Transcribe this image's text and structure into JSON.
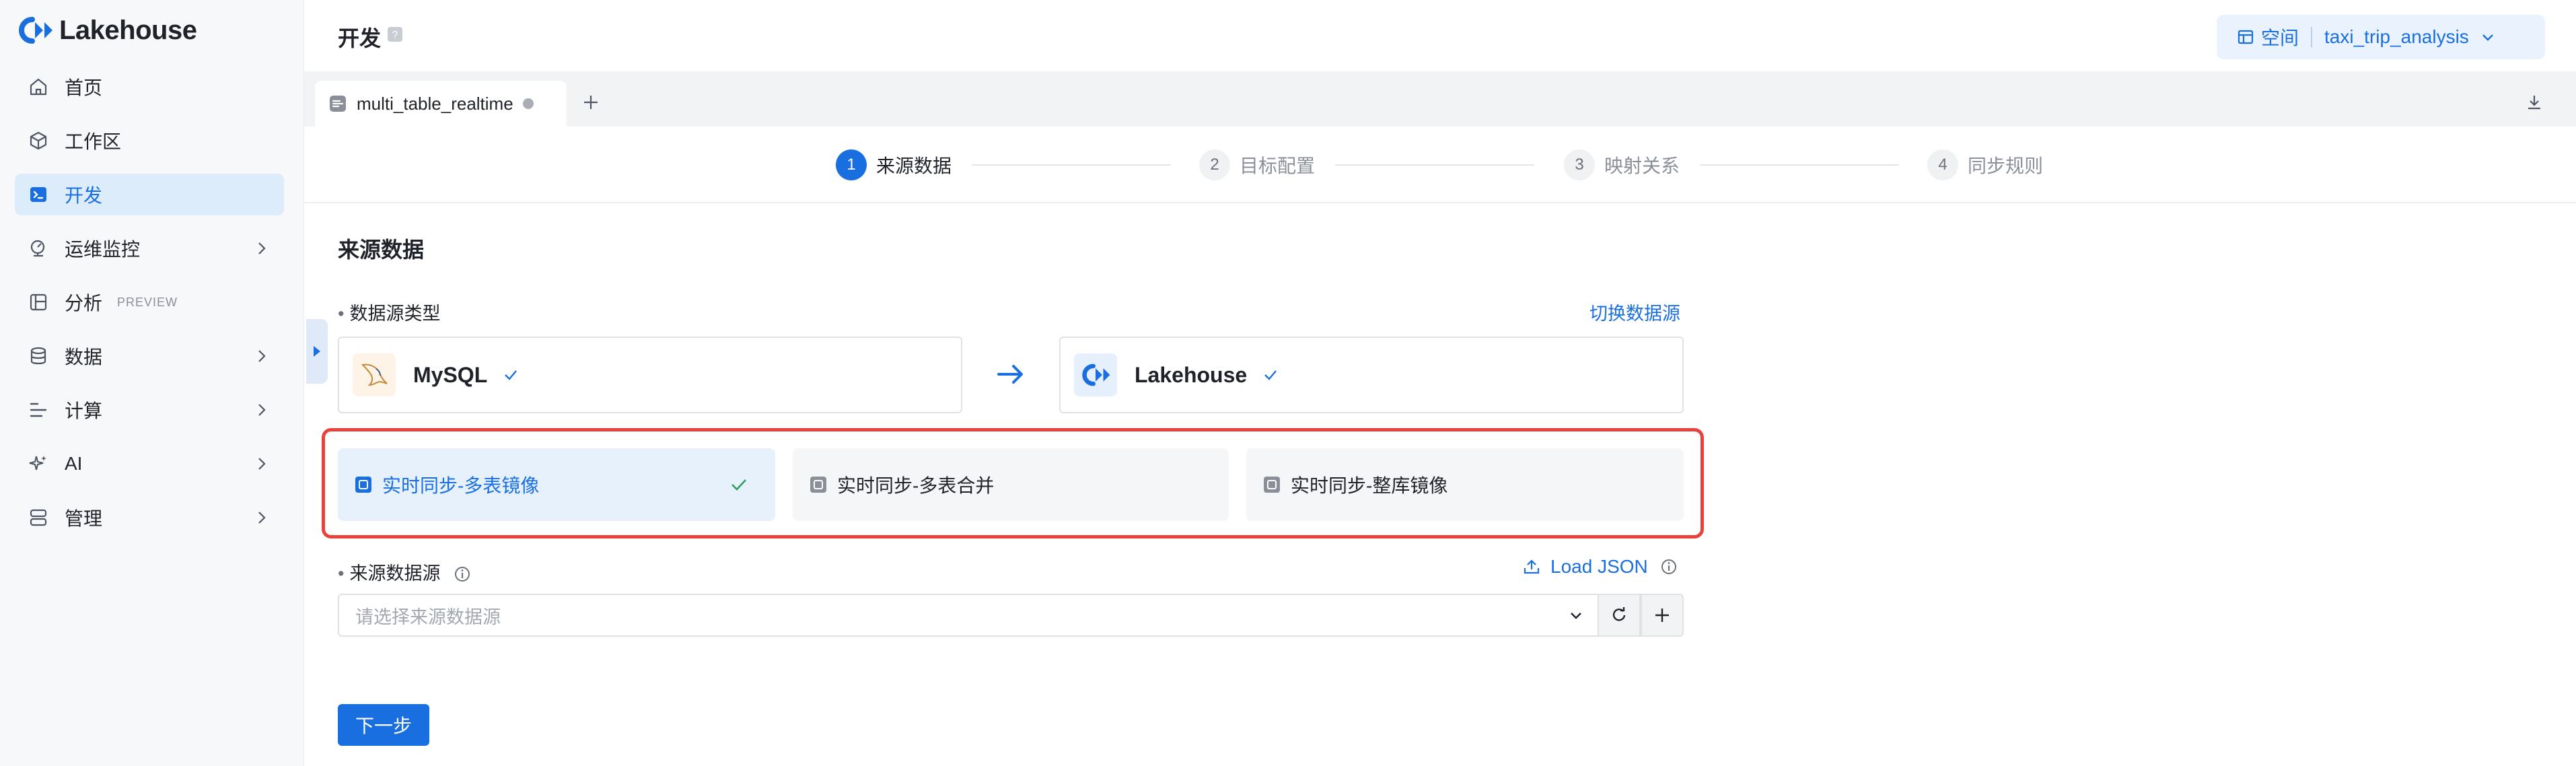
{
  "app": {
    "logo_text": "Lakehouse"
  },
  "sidebar": {
    "items": [
      {
        "label": "首页",
        "icon": "home-icon"
      },
      {
        "label": "工作区",
        "icon": "cube-icon"
      },
      {
        "label": "开发",
        "icon": "terminal-icon",
        "active": true
      },
      {
        "label": "运维监控",
        "icon": "monitor-icon",
        "has_children": true
      },
      {
        "label": "分析",
        "icon": "analysis-icon",
        "tag": "PREVIEW"
      },
      {
        "label": "数据",
        "icon": "database-icon",
        "has_children": true
      },
      {
        "label": "计算",
        "icon": "compute-icon",
        "has_children": true
      },
      {
        "label": "AI",
        "icon": "sparkle-icon",
        "has_children": true
      },
      {
        "label": "管理",
        "icon": "manage-icon",
        "has_children": true
      }
    ]
  },
  "header": {
    "title": "开发",
    "space_label": "空间",
    "space_value": "taxi_trip_analysis"
  },
  "tabs": {
    "items": [
      {
        "label": "multi_table_realtime",
        "unsaved": true
      }
    ]
  },
  "steps": [
    {
      "num": "1",
      "label": "来源数据",
      "active": true
    },
    {
      "num": "2",
      "label": "目标配置"
    },
    {
      "num": "3",
      "label": "映射关系"
    },
    {
      "num": "4",
      "label": "同步规则"
    }
  ],
  "main": {
    "section_title": "来源数据",
    "datasource_type_label": "数据源类型",
    "switch_datasource": "切换数据源",
    "source": {
      "name": "MySQL"
    },
    "target": {
      "name": "Lakehouse"
    },
    "sync_modes": [
      {
        "label": "实时同步-多表镜像",
        "selected": true
      },
      {
        "label": "实时同步-多表合并"
      },
      {
        "label": "实时同步-整库镜像"
      }
    ],
    "source_ds_label": "来源数据源",
    "load_json": "Load JSON",
    "select_placeholder": "请选择来源数据源",
    "next_button": "下一步"
  },
  "colors": {
    "accent": "#1a6fe0",
    "highlight_frame": "#e8423a",
    "sidebar_bg": "#f7f8fa",
    "success": "#2e9e5b"
  }
}
